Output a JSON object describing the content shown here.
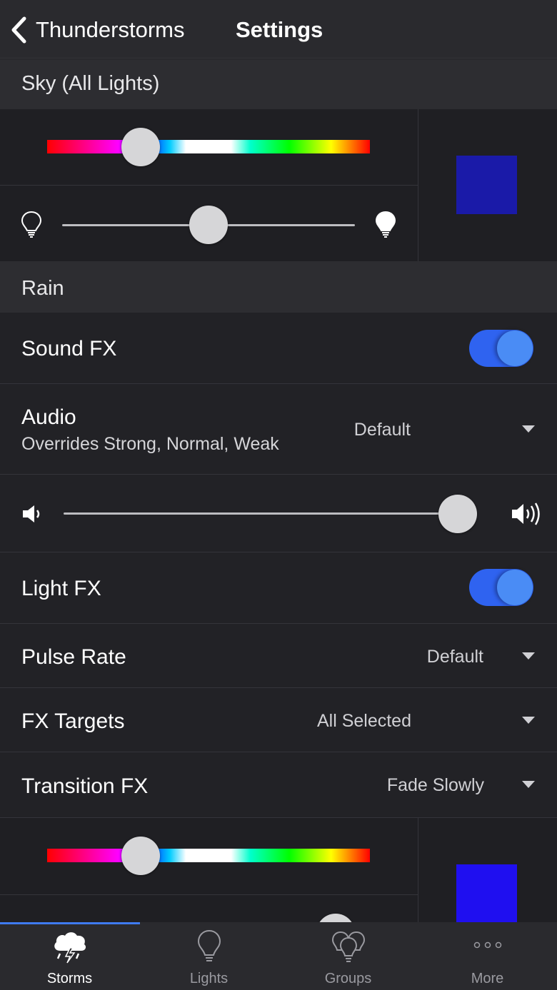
{
  "nav": {
    "back_label": "Thunderstorms",
    "title": "Settings"
  },
  "sky": {
    "header": "Sky (All Lights)",
    "hue_position": 0.29,
    "brightness_position": 0.5,
    "swatch_color": "#1a1aa8"
  },
  "rain": {
    "header": "Rain",
    "sound_fx": {
      "label": "Sound FX",
      "enabled": true
    },
    "audio": {
      "label": "Audio",
      "subtitle": "Overrides Strong, Normal, Weak",
      "value": "Default"
    },
    "volume_position": 0.96,
    "light_fx": {
      "label": "Light FX",
      "enabled": true
    },
    "pulse_rate": {
      "label": "Pulse Rate",
      "value": "Default"
    },
    "fx_targets": {
      "label": "FX Targets",
      "value": "All Selected"
    },
    "transition_fx": {
      "label": "Transition FX",
      "value": "Fade Slowly"
    },
    "hue_position": 0.29,
    "swatch_color": "#1f0ff0"
  },
  "tabs": [
    {
      "label": "Storms",
      "icon": "storm-cloud-icon",
      "active": true
    },
    {
      "label": "Lights",
      "icon": "light-bulb-icon",
      "active": false
    },
    {
      "label": "Groups",
      "icon": "bulb-group-icon",
      "active": false
    },
    {
      "label": "More",
      "icon": "more-dots-icon",
      "active": false
    }
  ],
  "colors": {
    "accent": "#2f63f0",
    "toggle_knob": "#4a8cf5",
    "background": "#222226"
  }
}
